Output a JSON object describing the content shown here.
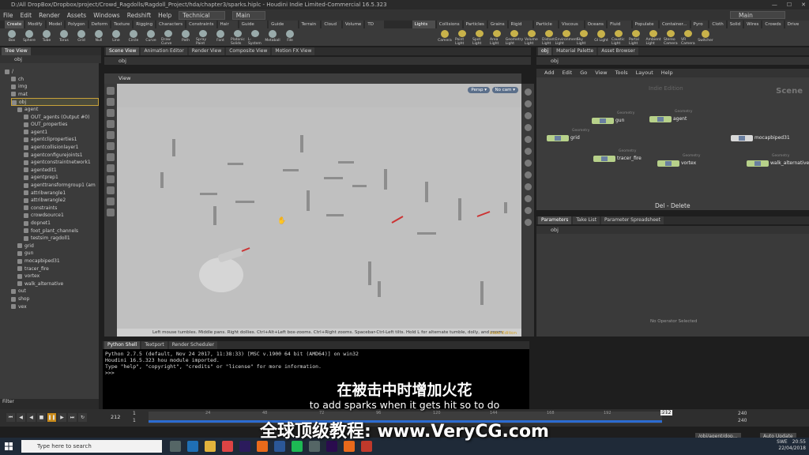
{
  "window": {
    "title": "D:/All DropBox/Dropbox/project/Crowd_Ragdolls/Ragdoll_Project/hda/chapter3/sparks.hiplc - Houdini Indie Limited-Commercial 16.5.323"
  },
  "menu": [
    "File",
    "Edit",
    "Render",
    "Assets",
    "Windows",
    "Redshift",
    "Help"
  ],
  "desktop": "Technical",
  "right_desktop": "Main",
  "main_tab_name": "Main",
  "shelf_tabs": [
    "Create",
    "Modify",
    "Model",
    "Polygon",
    "Deform",
    "Texture",
    "Rigging",
    "Characters",
    "Constraints",
    "Hair Utils",
    "Guide Process",
    "Guide Brushes",
    "Terrain FX",
    "Cloud FX",
    "Volume",
    "TD Tools"
  ],
  "shelf_tabs_right": [
    "Lights an...",
    "Collisions",
    "Particles",
    "Grains",
    "Rigid Bod...",
    "Particle Fl...",
    "Viscous Fl...",
    "Oceans",
    "Fluid Con...",
    "Populate C...",
    "Container...",
    "Pyro FX",
    "Cloth",
    "Solid",
    "Wires",
    "Crowds",
    "Drive Sim..."
  ],
  "tools": [
    "Box",
    "Sphere",
    "Tube",
    "Torus",
    "Grid",
    "Null",
    "Line",
    "Circle",
    "Curve",
    "Draw Curve",
    "Path",
    "Spray Paint",
    "Font",
    "Platonic Solids",
    "L-System",
    "Metaball",
    "File"
  ],
  "tools_right": [
    "Camera",
    "Point Light",
    "Spot Light",
    "Area Light",
    "Geometry Light",
    "Volume Light",
    "Distant Light",
    "Environment Light",
    "Sky Light",
    "GI Light",
    "Caustic Light",
    "Portal Light",
    "Ambient Light",
    "Stereo Camera",
    "VR Camera",
    "Switcher"
  ],
  "left_tabs": [
    "Tree View"
  ],
  "tree_path": "obj",
  "tree_items": [
    {
      "label": "/",
      "indent": 0
    },
    {
      "label": "ch",
      "indent": 1
    },
    {
      "label": "img",
      "indent": 1
    },
    {
      "label": "mat",
      "indent": 1
    },
    {
      "label": "obj",
      "indent": 1,
      "selected": true
    },
    {
      "label": "agent",
      "indent": 2
    },
    {
      "label": "OUT_agents (Output #0)",
      "indent": 3
    },
    {
      "label": "OUT_properties",
      "indent": 3
    },
    {
      "label": "agent1",
      "indent": 3
    },
    {
      "label": "agentcliproperties1",
      "indent": 3
    },
    {
      "label": "agentcollisionlayer1",
      "indent": 3
    },
    {
      "label": "agentconfigurejoints1",
      "indent": 3
    },
    {
      "label": "agentconstraintnetwork1",
      "indent": 3
    },
    {
      "label": "agentedit1",
      "indent": 3
    },
    {
      "label": "agentprep1",
      "indent": 3
    },
    {
      "label": "agenttransformgroup1 (am",
      "indent": 3
    },
    {
      "label": "attribwrangle1",
      "indent": 3
    },
    {
      "label": "attribwrangle2",
      "indent": 3
    },
    {
      "label": "constraints",
      "indent": 3
    },
    {
      "label": "crowdsource1",
      "indent": 3
    },
    {
      "label": "dopnet1",
      "indent": 3
    },
    {
      "label": "foot_plant_channels",
      "indent": 3
    },
    {
      "label": "testsim_ragdoll1",
      "indent": 3
    },
    {
      "label": "grid",
      "indent": 2
    },
    {
      "label": "gun",
      "indent": 2
    },
    {
      "label": "mocapbiped31",
      "indent": 2
    },
    {
      "label": "tracer_fire",
      "indent": 2
    },
    {
      "label": "vortex",
      "indent": 2
    },
    {
      "label": "walk_alternative",
      "indent": 2
    },
    {
      "label": "out",
      "indent": 1
    },
    {
      "label": "shop",
      "indent": 1
    },
    {
      "label": "vex",
      "indent": 1
    }
  ],
  "filter_label": "Filter",
  "center_tabs": [
    "Scene View",
    "Animation Editor",
    "Render View",
    "Composite View",
    "Motion FX View"
  ],
  "viewport": {
    "path": "obj",
    "title": "View",
    "persp": "Persp ▾",
    "cam": "No cam ▾",
    "hint": "Left mouse tumbles. Middle pans. Right dollies. Ctrl+Alt+Left box-zooms. Ctrl+Right zooms. Spacebar-Ctrl-Left tilts. Hold L for alternate tumble, dolly, and zoom.",
    "indie": "Indie Edition"
  },
  "shell_tabs": [
    "Python Shell",
    "Textport",
    "Render Scheduler"
  ],
  "shell_lines": [
    "Python 2.7.5 (default, Nov 24 2017, 11:38:33) [MSC v.1900 64 bit (AMD64)] on win32",
    "Houdini 16.5.323 hou module imported.",
    "Type \"help\", \"copyright\", \"credits\" or \"license\" for more information.",
    ">>>"
  ],
  "network": {
    "tabs": [
      "obj",
      "Material Palette",
      "Asset Browser"
    ],
    "path": "obj",
    "menu": [
      "Add",
      "Edit",
      "Go",
      "View",
      "Tools",
      "Layout",
      "Help"
    ],
    "indie": "Indie Edition",
    "scene": "Scene",
    "del": "Del - Delete",
    "nodes": [
      {
        "label": "gun",
        "type": "Geometry"
      },
      {
        "label": "agent",
        "type": "Geometry"
      },
      {
        "label": "grid",
        "type": "Geometry"
      },
      {
        "label": "mocapbiped31",
        "type": ""
      },
      {
        "label": "tracer_fire",
        "type": "Geometry"
      },
      {
        "label": "vortex",
        "type": "Geometry"
      },
      {
        "label": "walk_alternative",
        "type": "Geometry"
      }
    ]
  },
  "params": {
    "tabs": [
      "Parameters",
      "Take List",
      "Parameter Spreadsheet"
    ],
    "path": "obj",
    "empty": "No Operator Selected"
  },
  "timeline": {
    "frame": "212",
    "start": "1",
    "end": "240",
    "end2": "240",
    "ticks": [
      "24",
      "48",
      "72",
      "96",
      "120",
      "144",
      "168",
      "192",
      "216"
    ],
    "current": "212",
    "total": "240"
  },
  "status": {
    "path": "/obj/agent/dop...",
    "update": "Auto Update"
  },
  "taskbar": {
    "search": "Type here to search",
    "lang": "SWE",
    "time": "20:55",
    "date": "22/04/2018"
  },
  "subtitles": {
    "zh": "在被击中时增加火花",
    "en": "to add sparks when it gets hit so to do",
    "brand": "全球顶级教程:",
    "url": "www.VeryCG.com"
  }
}
